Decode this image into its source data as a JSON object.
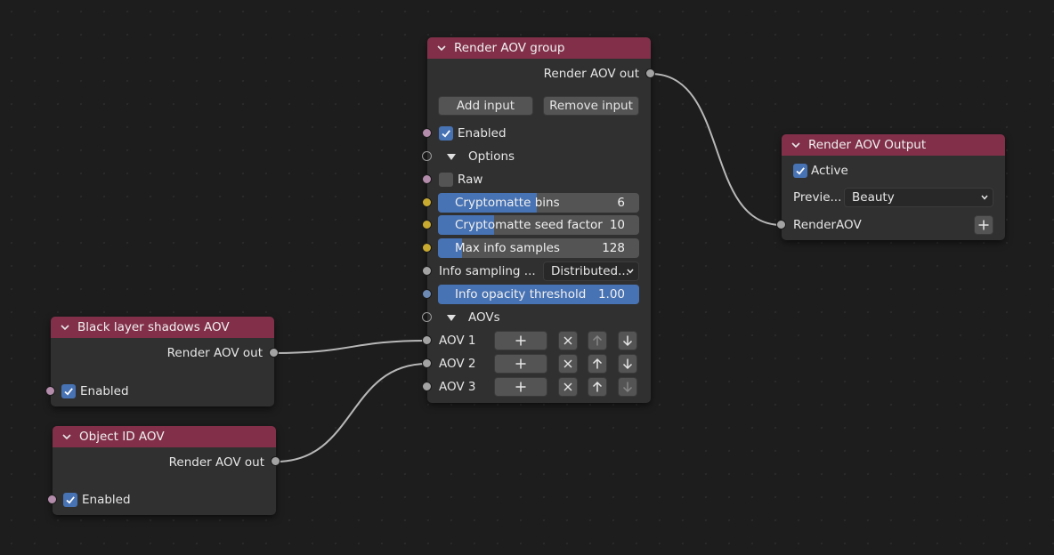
{
  "colors": {
    "header": "#82304a",
    "node_body": "#303030",
    "accent_blue": "#4772b3",
    "socket_grey": "#a3a3a3",
    "socket_purple": "#b48cab",
    "socket_yellow": "#c9aa30",
    "socket_blue": "#6d8ab5"
  },
  "nodes": {
    "group": {
      "title": "Render AOV group",
      "output_label": "Render AOV out",
      "add_input": "Add input",
      "remove_input": "Remove input",
      "enabled_label": "Enabled",
      "enabled_checked": true,
      "options_label": "Options",
      "raw_label": "Raw",
      "raw_checked": false,
      "crypto_bins_label": "Cryptomatte bins",
      "crypto_bins_value": "6",
      "crypto_bins_fill": 0.49,
      "crypto_seed_label": "Cryptomatte seed factor",
      "crypto_seed_value": "10",
      "crypto_seed_fill": 0.28,
      "max_info_label": "Max info samples",
      "max_info_value": "128",
      "max_info_fill": 0.12,
      "info_sampling_label": "Info sampling ...",
      "info_sampling_value": "Distributed...",
      "info_opacity_label": "Info opacity threshold",
      "info_opacity_value": "1.00",
      "info_opacity_fill": 1.0,
      "aovs_label": "AOVs",
      "aov_rows": [
        {
          "label": "AOV 1",
          "up_enabled": false,
          "down_enabled": true
        },
        {
          "label": "AOV 2",
          "up_enabled": true,
          "down_enabled": true
        },
        {
          "label": "AOV 3",
          "up_enabled": true,
          "down_enabled": false
        }
      ]
    },
    "black_layer": {
      "title": "Black layer shadows AOV",
      "output_label": "Render AOV out",
      "enabled_label": "Enabled",
      "enabled_checked": true
    },
    "object_id": {
      "title": "Object ID AOV",
      "output_label": "Render AOV out",
      "enabled_label": "Enabled",
      "enabled_checked": true
    },
    "output": {
      "title": "Render AOV Output",
      "active_label": "Active",
      "active_checked": true,
      "preview_label": "Previe...",
      "preview_value": "Beauty",
      "input_label": "RenderAOV"
    }
  }
}
